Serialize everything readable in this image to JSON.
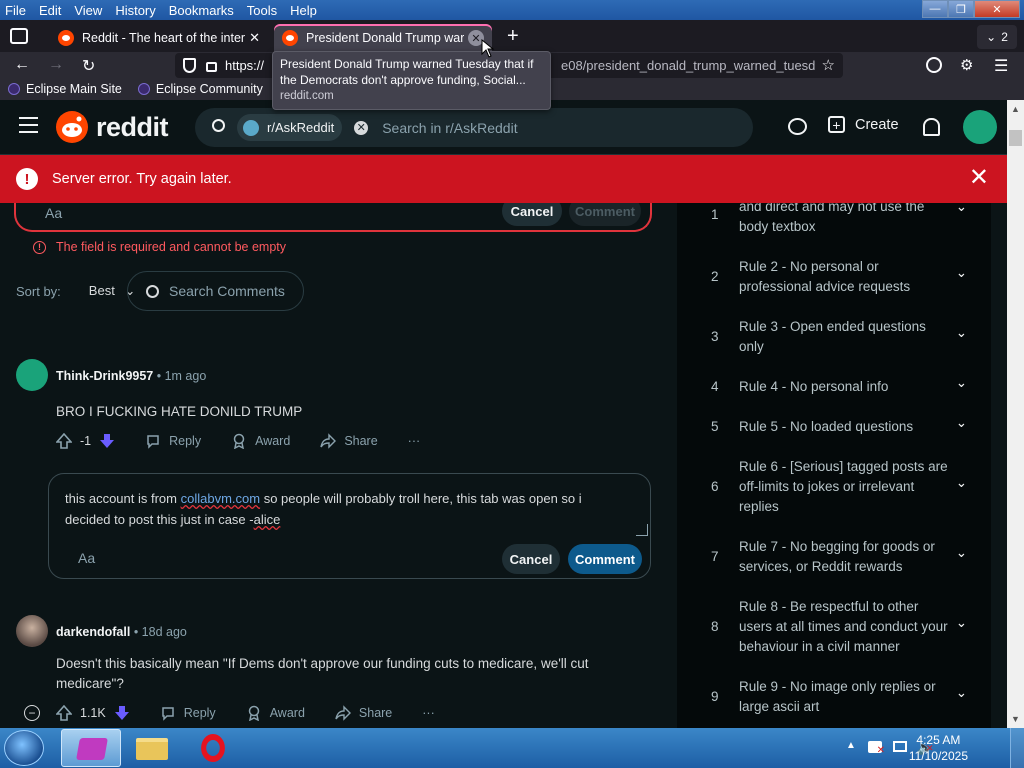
{
  "menubar": {
    "items": [
      "File",
      "Edit",
      "View",
      "History",
      "Bookmarks",
      "Tools",
      "Help"
    ]
  },
  "tabs": [
    {
      "title": "Reddit - The heart of the interne"
    },
    {
      "title": "President Donald Trump warnec"
    }
  ],
  "tab_count": "2",
  "url": "https://",
  "url_tail": "e08/president_donald_trump_warned_tuesd",
  "bookmarks": [
    "Eclipse Main Site",
    "Eclipse Community"
  ],
  "tooltip": {
    "title": "President Donald Trump warned Tuesday that if the Democrats don't approve funding, Social...",
    "domain": "reddit.com"
  },
  "reddit": {
    "logo": "reddit",
    "subreddit_chip": "r/AskReddit",
    "search_placeholder": "Search in r/AskReddit",
    "create_label": "Create"
  },
  "error_banner": {
    "text": "Server error. Try again later."
  },
  "top_composer": {
    "format_label": "Aa",
    "cancel_label": "Cancel",
    "comment_label": "Comment",
    "field_error": "The field is required and cannot be empty"
  },
  "sort": {
    "label": "Sort by:",
    "value": "Best",
    "search_placeholder": "Search Comments"
  },
  "comments": [
    {
      "author": "Think-Drink9957",
      "time": "• 1m ago",
      "body": "BRO I FUCKING HATE DONILD TRUMP",
      "score": "-1",
      "reply": "Reply",
      "award": "Award",
      "share": "Share",
      "more": "···"
    },
    {
      "author": "darkendofall",
      "time": "• 18d ago",
      "body": "Doesn't this basically mean \"If Dems don't approve our funding cuts to medicare, we'll cut medicare\"?",
      "score": "1.1K",
      "reply": "Reply",
      "award": "Award",
      "share": "Share",
      "more": "···"
    }
  ],
  "reply_composer": {
    "text_before": "this account is from ",
    "link": "collabvm.com",
    "text_after": " so people will probably troll here, this tab was open so i decided to post this just in case    -",
    "signature": "alice",
    "format_label": "Aa",
    "cancel_label": "Cancel",
    "comment_label": "Comment"
  },
  "rules": [
    {
      "num": "1",
      "text": "and direct and may not use the body textbox"
    },
    {
      "num": "2",
      "text": "Rule 2 - No personal or professional advice requests"
    },
    {
      "num": "3",
      "text": "Rule 3 - Open ended questions only"
    },
    {
      "num": "4",
      "text": "Rule 4 - No personal info"
    },
    {
      "num": "5",
      "text": "Rule 5 - No loaded questions"
    },
    {
      "num": "6",
      "text": "Rule 6 - [Serious] tagged posts are off-limits to jokes or irrelevant replies"
    },
    {
      "num": "7",
      "text": "Rule 7 - No begging for goods or services, or Reddit rewards"
    },
    {
      "num": "8",
      "text": "Rule 8 - Be respectful to other users at all times and conduct your behaviour in a civil manner"
    },
    {
      "num": "9",
      "text": "Rule 9 - No image only replies or large ascii art"
    }
  ],
  "taskbar": {
    "time": "4:25 AM",
    "date": "11/10/2025"
  },
  "colors": {
    "reddit_orange": "#ff4500",
    "error_red": "#cc1420",
    "downvote": "#6a5cff",
    "comment_button": "#0d5a8c"
  }
}
